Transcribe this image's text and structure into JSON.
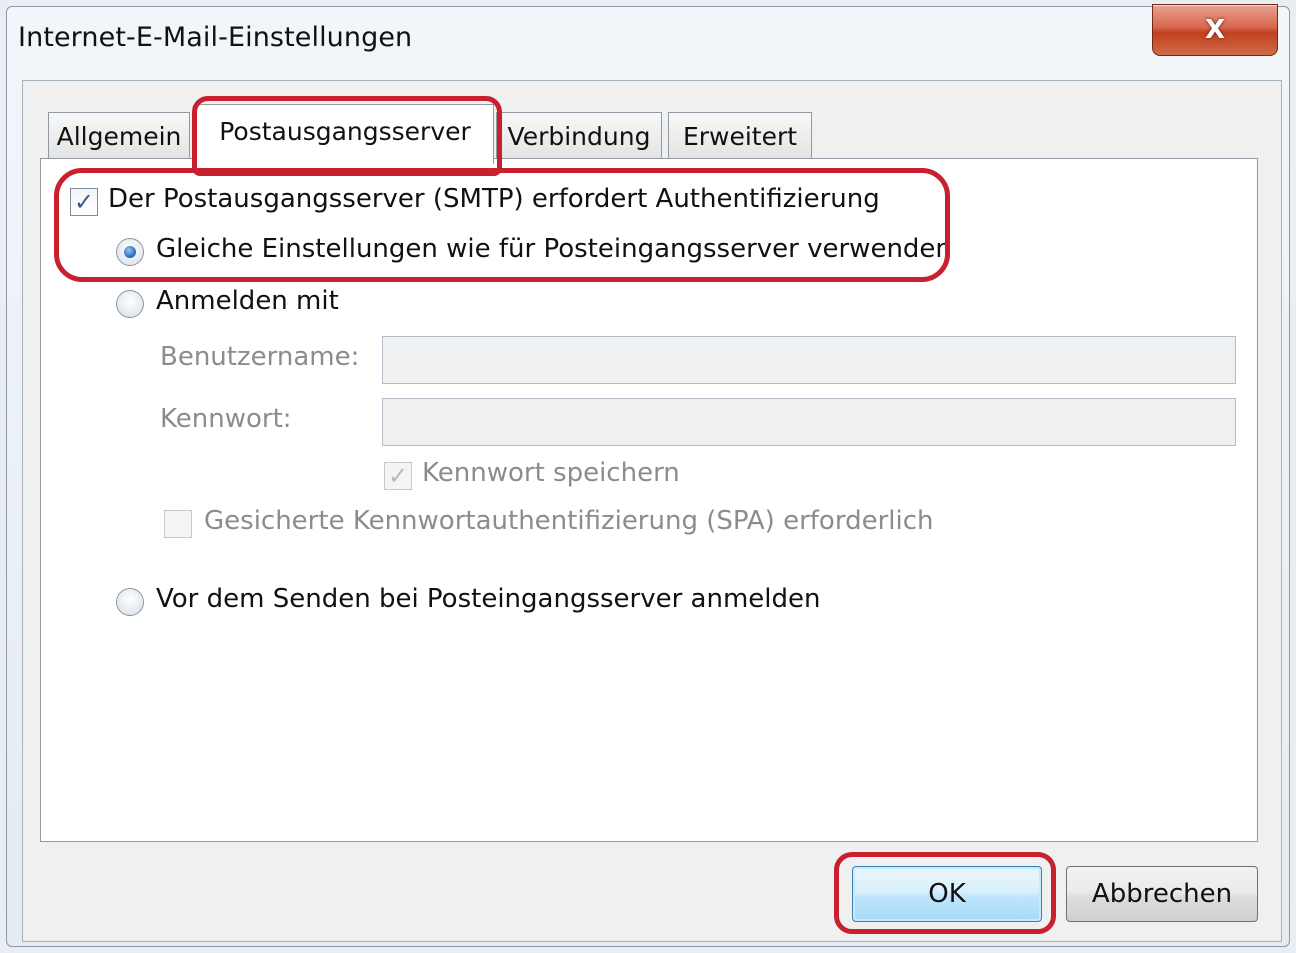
{
  "window": {
    "title": "Internet-E-Mail-Einstellungen",
    "close_glyph": "X"
  },
  "tabs": [
    {
      "label": "Allgemein",
      "active": false
    },
    {
      "label": "Postausgangsserver",
      "active": true
    },
    {
      "label": "Verbindung",
      "active": false
    },
    {
      "label": "Erweitert",
      "active": false
    }
  ],
  "form": {
    "smtp_auth": {
      "label": "Der Postausgangsserver (SMTP) erfordert Authentifizierung",
      "checked": true
    },
    "radio_same_settings": {
      "label": "Gleiche Einstellungen wie für Posteingangsserver verwenden",
      "selected": true
    },
    "radio_login_with": {
      "label": "Anmelden mit",
      "selected": false
    },
    "username": {
      "label": "Benutzername:",
      "value": ""
    },
    "password": {
      "label": "Kennwort:",
      "value": ""
    },
    "save_password": {
      "label": "Kennwort speichern",
      "checked": true,
      "disabled": true
    },
    "spa": {
      "label": "Gesicherte Kennwortauthentifizierung (SPA) erforderlich",
      "checked": false,
      "disabled": true
    },
    "radio_pop_before_smtp": {
      "label": "Vor dem Senden bei Posteingangsserver anmelden",
      "selected": false
    }
  },
  "buttons": {
    "ok": "OK",
    "cancel": "Abbrechen"
  },
  "colors": {
    "annotation": "#c8202e",
    "ok_border": "#3c7fb1",
    "close_button": "#c2401f"
  }
}
